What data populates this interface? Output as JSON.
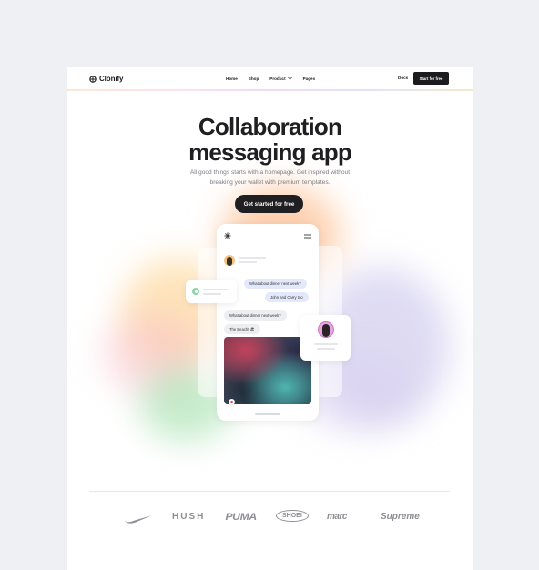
{
  "nav": {
    "brand": "Clonify",
    "links": [
      "Home",
      "Shop",
      "Product",
      "Pages"
    ],
    "docs": "Docs",
    "start_label": "Start for free"
  },
  "hero": {
    "title_line1": "Collaboration",
    "title_line2": "messaging app",
    "subtitle_line1": "All good things starts with a homepage. Get inspired without",
    "subtitle_line2": "breaking your wallet with premium templates.",
    "cta_label": "Get started for free"
  },
  "chat": {
    "msg1": "What about dinner next week?",
    "msg2": "John and Carry too",
    "msg3": "What about dinner next week?",
    "msg4": "The Beach! 🏖"
  },
  "brands": [
    "nike-logo",
    "HUSH",
    "PUMA",
    "SHOEI",
    "marc",
    "Supreme"
  ],
  "colors": {
    "dark": "#1f1f22",
    "page_bg": "#eef0f4",
    "bubble_blue": "#e3e9fb",
    "bubble_gray": "#eceef1"
  }
}
